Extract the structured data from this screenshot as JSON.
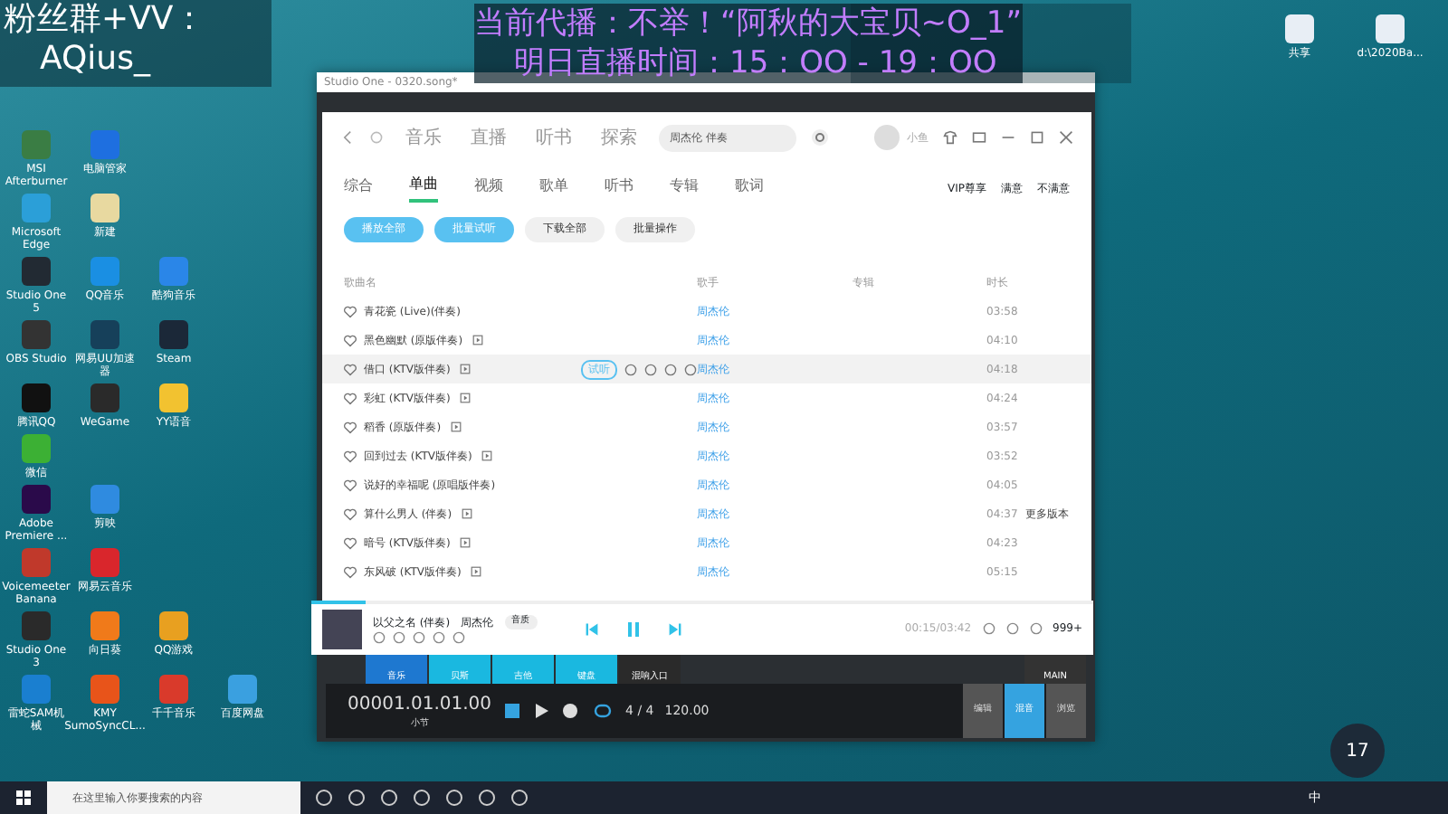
{
  "overlay": {
    "group": "粉丝群+VV：",
    "account": "AQius_",
    "now_line": "当前代播：不举！“阿秋的大宝贝~O_1”",
    "schedule_line": "明日直播时间：15：OO - 19：OO"
  },
  "desktop_icons": [
    [
      {
        "label": "MSI Afterburner",
        "color": "#3a7d44"
      },
      {
        "label": "电脑管家",
        "color": "#1e6fe0"
      }
    ],
    [
      {
        "label": "Microsoft Edge",
        "color": "#2b9fd8"
      },
      {
        "label": "新建",
        "color": "#e8d9a0"
      }
    ],
    [
      {
        "label": "Studio One 5",
        "color": "#222a33"
      },
      {
        "label": "QQ音乐",
        "color": "#1a8fe3"
      },
      {
        "label": "酷狗音乐",
        "color": "#2a86e8"
      }
    ],
    [
      {
        "label": "OBS Studio",
        "color": "#333333"
      },
      {
        "label": "网易UU加速器",
        "color": "#16405a"
      },
      {
        "label": "Steam",
        "color": "#1b2838"
      }
    ],
    [
      {
        "label": "腾讯QQ",
        "color": "#111111"
      },
      {
        "label": "WeGame",
        "color": "#2a2a2a"
      },
      {
        "label": "YY语音",
        "color": "#f2c230"
      }
    ],
    [
      {
        "label": "微信",
        "color": "#3cb034"
      }
    ],
    [
      {
        "label": "Adobe Premiere ...",
        "color": "#2a0a4a"
      },
      {
        "label": "剪映",
        "color": "#2f8be0"
      }
    ],
    [
      {
        "label": "Voicemeeter Banana",
        "color": "#c0392b"
      },
      {
        "label": "网易云音乐",
        "color": "#d9262c"
      }
    ],
    [
      {
        "label": "Studio One 3",
        "color": "#2a2a2a"
      },
      {
        "label": "向日葵",
        "color": "#f07a1a"
      },
      {
        "label": "QQ游戏",
        "color": "#e8a020"
      }
    ],
    [
      {
        "label": "雷蛇SAM机械",
        "color": "#1a7fd0"
      },
      {
        "label": "KMY SumoSyncCL...",
        "color": "#e8541a"
      },
      {
        "label": "千千音乐",
        "color": "#d93a2b"
      },
      {
        "label": "百度网盘",
        "color": "#3aa0e0"
      }
    ]
  ],
  "right_icons": [
    {
      "label": "共享"
    },
    {
      "label": "d:\\2020Ba..."
    }
  ],
  "studio_one": {
    "title": "Studio One - 0320.song*",
    "time": "00001.01.01.00",
    "time_unit": "小节",
    "signature": "4 / 4",
    "tempo": "120.00",
    "tracks": [
      {
        "name": "音乐",
        "color": "#1e78d0"
      },
      {
        "name": "贝斯",
        "color": "#1ab8e0"
      },
      {
        "name": "吉他",
        "color": "#1ab8e0"
      },
      {
        "name": "键盘",
        "color": "#1ab8e0"
      },
      {
        "name": "混响入口",
        "color": "#2a2a2a"
      }
    ],
    "master": "MAIN",
    "modes": [
      {
        "label": "编辑",
        "selected": false
      },
      {
        "label": "混音",
        "selected": true
      },
      {
        "label": "浏览",
        "selected": false
      }
    ]
  },
  "music_app": {
    "nav": [
      {
        "label": "音乐",
        "selected": false
      },
      {
        "label": "直播",
        "selected": false
      },
      {
        "label": "听书",
        "selected": false
      },
      {
        "label": "探索",
        "selected": false
      }
    ],
    "search": {
      "value": "周杰伦 伴奏"
    },
    "user": "小鱼",
    "tabs": [
      {
        "label": "综合",
        "selected": false
      },
      {
        "label": "单曲",
        "selected": true
      },
      {
        "label": "视频",
        "selected": false
      },
      {
        "label": "歌单",
        "selected": false
      },
      {
        "label": "听书",
        "selected": false
      },
      {
        "label": "专辑",
        "selected": false
      },
      {
        "label": "歌词",
        "selected": false
      }
    ],
    "filters": [
      "VIP尊享",
      "满意",
      "不满意"
    ],
    "actions": [
      {
        "label": "播放全部",
        "kind": "primary"
      },
      {
        "label": "批量试听",
        "kind": "primary"
      },
      {
        "label": "下载全部",
        "kind": "secondary"
      },
      {
        "label": "批量操作",
        "kind": "secondary"
      }
    ],
    "columns": [
      "歌曲名",
      "歌手",
      "专辑",
      "时长"
    ],
    "rows": [
      {
        "title": "青花瓷 (Live)(伴奏)",
        "artist": "周杰伦",
        "duration": "03:58",
        "mv": false,
        "selected": false
      },
      {
        "title": "黑色幽默 (原版伴奏)",
        "artist": "周杰伦",
        "duration": "04:10",
        "mv": true,
        "selected": false
      },
      {
        "title": "借口 (KTV版伴奏)",
        "artist": "周杰伦",
        "duration": "04:18",
        "mv": true,
        "selected": true,
        "hover_tag": "试听"
      },
      {
        "title": "彩虹 (KTV版伴奏)",
        "artist": "周杰伦",
        "duration": "04:24",
        "mv": true,
        "selected": false
      },
      {
        "title": "稻香 (原版伴奏)",
        "artist": "周杰伦",
        "duration": "03:57",
        "mv": true,
        "selected": false
      },
      {
        "title": "回到过去 (KTV版伴奏)",
        "artist": "周杰伦",
        "duration": "03:52",
        "mv": true,
        "selected": false
      },
      {
        "title": "说好的幸福呢 (原唱版伴奏)",
        "artist": "周杰伦",
        "duration": "04:05",
        "mv": false,
        "selected": false
      },
      {
        "title": "算什么男人 (伴奏)",
        "artist": "周杰伦",
        "duration": "04:37",
        "mv": true,
        "selected": false,
        "extra": "更多版本"
      },
      {
        "title": "暗号 (KTV版伴奏)",
        "artist": "周杰伦",
        "duration": "04:23",
        "mv": true,
        "selected": false
      },
      {
        "title": "东风破 (KTV版伴奏)",
        "artist": "周杰伦",
        "duration": "05:15",
        "mv": true,
        "selected": false
      }
    ],
    "player": {
      "title": "以父之名 (伴奏)",
      "artist": "周杰伦",
      "tag": "音质",
      "time": "00:15/03:42",
      "count": "999+",
      "level": 0.07
    }
  },
  "taskbar": {
    "search": {
      "placeholder": "在这里输入你要搜索的内容"
    },
    "weather": "17",
    "ime": "中"
  }
}
